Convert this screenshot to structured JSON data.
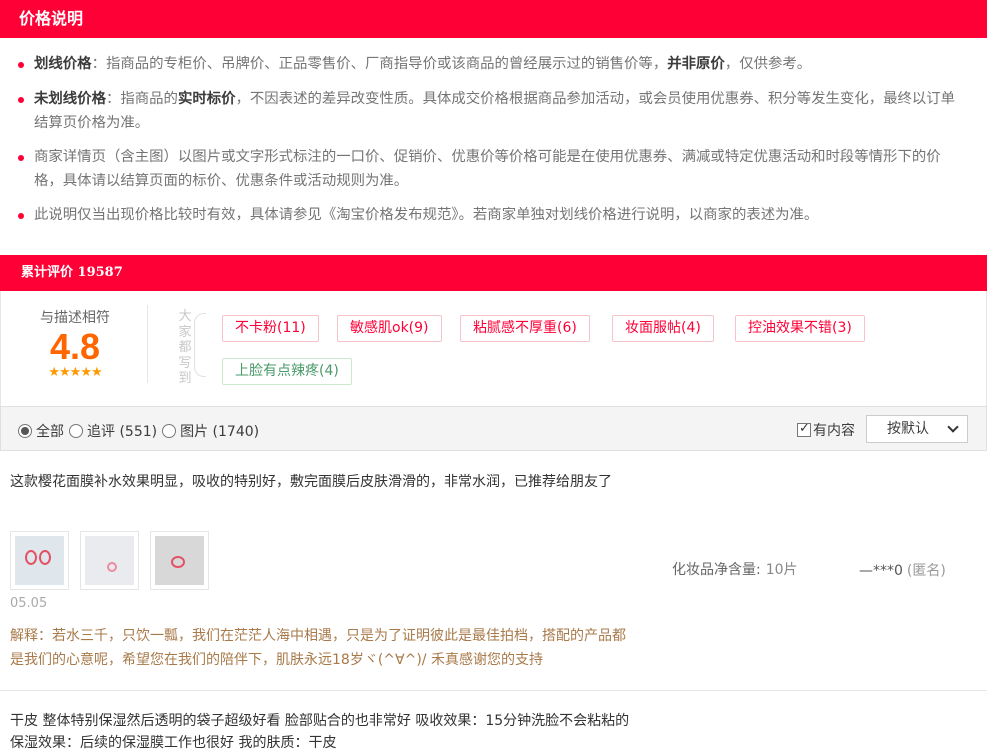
{
  "price_section": {
    "title": "价格说明",
    "items": [
      {
        "term": "划线价格",
        "pre": "：指商品的专柜价、吊牌价、正品零售价、厂商指导价或该商品的曾经展示过的销售价等，",
        "bold": "并非原价",
        "post": "，仅供参考。"
      },
      {
        "term": "未划线价格",
        "pre": "：指商品的",
        "bold": "实时标价",
        "post": "，不因表述的差异改变性质。具体成交价格根据商品参加活动，或会员使用优惠券、积分等发生变化，最终以订单结算页价格为准。"
      },
      {
        "text": "商家详情页（含主图）以图片或文字形式标注的一口价、促销价、优惠价等价格可能是在使用优惠券、满减或特定优惠活动和时段等情形下的价格，具体请以结算页面的标价、优惠条件或活动规则为准。"
      },
      {
        "text": "此说明仅当出现价格比较时有效，具体请参见《淘宝价格发布规范》。若商家单独对划线价格进行说明，以商家的表述为准。"
      }
    ]
  },
  "rating_section": {
    "title": "累计评价 19587",
    "score_label": "与描述相符",
    "score": "4.8",
    "stars": "★★★★★",
    "stars_value": 5,
    "vertical_label": "大家都写到",
    "tags": [
      {
        "label": "不卡粉(11)",
        "kind": "pos"
      },
      {
        "label": "敏感肌ok(9)",
        "kind": "pos"
      },
      {
        "label": "粘腻感不厚重(6)",
        "kind": "pos"
      },
      {
        "label": "妆面服帖(4)",
        "kind": "pos"
      },
      {
        "label": "控油效果不错(3)",
        "kind": "pos"
      },
      {
        "label": "上脸有点辣疼(4)",
        "kind": "neg"
      }
    ]
  },
  "filter_bar": {
    "radios": [
      {
        "label": "全部",
        "selected": true
      },
      {
        "label": "追评 (551)",
        "selected": false
      },
      {
        "label": "图片 (1740)",
        "selected": false
      }
    ],
    "has_content_label": "有内容",
    "has_content_checked": true,
    "sort_label": "按默认"
  },
  "reviews": [
    {
      "text": "这款樱花面膜补水效果明显，吸收的特别好，敷完面膜后皮肤滑滑的，非常水润，已推荐给朋友了",
      "date": "05.05",
      "reply": "解释：若水三千，只饮一瓢，我们在茫茫人海中相遇，只是为了证明彼此是最佳拍档，搭配的产品都是我们的心意呢，希望您在我们的陪伴下，肌肤永远18岁ヾ(^∀^)/ 禾真感谢您的支持",
      "sku_label": "化妆品净含量:",
      "sku_value": "10片",
      "user": "—***0",
      "anon": "(匿名)"
    },
    {
      "text": "干皮 整体特别保湿然后透明的袋子超级好看 脸部贴合的也非常好 吸收效果：15分钟洗脸不会粘粘的 保湿效果：后续的保湿膜工作也很好 我的肤质：干皮"
    }
  ],
  "colors": {
    "brand_red": "#ff0036",
    "score_orange": "#ff6600",
    "star": "#ff9900",
    "reply_brown": "#a87a4a"
  }
}
